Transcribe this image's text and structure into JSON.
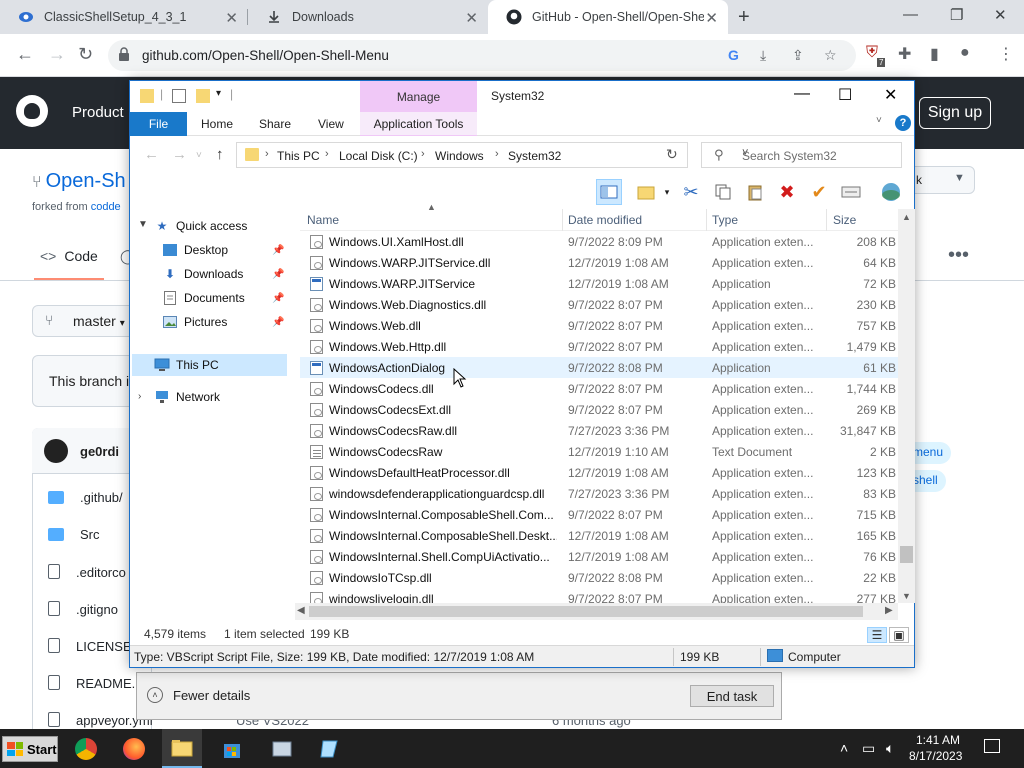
{
  "browser": {
    "tabs": [
      {
        "title": "ClassicShellSetup_4_3_1",
        "icon": "classic-shell-icon"
      },
      {
        "title": "Downloads",
        "icon": "download-icon"
      },
      {
        "title": "GitHub - Open-Shell/Open-Shell",
        "icon": "github-icon"
      }
    ],
    "url": "github.com/Open-Shell/Open-Shell-Menu",
    "extension_badge": "7"
  },
  "github": {
    "product_label": "Product",
    "signup_label": "Sign up",
    "repo_name": "Open-Sh",
    "forked_from_label": "forked from",
    "forked_from_link": "codde",
    "code_tab": "Code",
    "branch": "master",
    "notice": "This branch is",
    "commit_author": "ge0rdi",
    "files": [
      ".github/",
      "Src",
      ".editorco",
      ".gitigno",
      "LICENSE",
      "README.",
      "appveyor.yml"
    ],
    "chips": [
      "menu",
      "shell"
    ],
    "right_box_label": "k",
    "bottom_commit_msg": "Use VS2022",
    "bottom_commit_time": "6 months ago"
  },
  "explorer": {
    "title": "System32",
    "manage_label": "Manage",
    "ribbon_tabs": {
      "file": "File",
      "home": "Home",
      "share": "Share",
      "view": "View",
      "app_tools": "Application Tools"
    },
    "breadcrumbs": [
      "This PC",
      "Local Disk (C:)",
      "Windows",
      "System32"
    ],
    "search_placeholder": "Search System32",
    "nav": {
      "quick_access": "Quick access",
      "desktop": "Desktop",
      "downloads": "Downloads",
      "documents": "Documents",
      "pictures": "Pictures",
      "this_pc": "This PC",
      "network": "Network"
    },
    "columns": {
      "name": "Name",
      "date": "Date modified",
      "type": "Type",
      "size": "Size"
    },
    "files": [
      {
        "name": "Windows.UI.XamlHost.dll",
        "date": "9/7/2022 8:09 PM",
        "type": "Application exten...",
        "size": "208 KB",
        "kind": "dll"
      },
      {
        "name": "Windows.WARP.JITService.dll",
        "date": "12/7/2019 1:08 AM",
        "type": "Application exten...",
        "size": "64 KB",
        "kind": "dll"
      },
      {
        "name": "Windows.WARP.JITService",
        "date": "12/7/2019 1:08 AM",
        "type": "Application",
        "size": "72 KB",
        "kind": "app"
      },
      {
        "name": "Windows.Web.Diagnostics.dll",
        "date": "9/7/2022 8:07 PM",
        "type": "Application exten...",
        "size": "230 KB",
        "kind": "dll"
      },
      {
        "name": "Windows.Web.dll",
        "date": "9/7/2022 8:07 PM",
        "type": "Application exten...",
        "size": "757 KB",
        "kind": "dll"
      },
      {
        "name": "Windows.Web.Http.dll",
        "date": "9/7/2022 8:07 PM",
        "type": "Application exten...",
        "size": "1,479 KB",
        "kind": "dll"
      },
      {
        "name": "WindowsActionDialog",
        "date": "9/7/2022 8:08 PM",
        "type": "Application",
        "size": "61 KB",
        "kind": "app"
      },
      {
        "name": "WindowsCodecs.dll",
        "date": "9/7/2022 8:07 PM",
        "type": "Application exten...",
        "size": "1,744 KB",
        "kind": "dll"
      },
      {
        "name": "WindowsCodecsExt.dll",
        "date": "9/7/2022 8:07 PM",
        "type": "Application exten...",
        "size": "269 KB",
        "kind": "dll"
      },
      {
        "name": "WindowsCodecsRaw.dll",
        "date": "7/27/2023 3:36 PM",
        "type": "Application exten...",
        "size": "31,847 KB",
        "kind": "dll"
      },
      {
        "name": "WindowsCodecsRaw",
        "date": "12/7/2019 1:10 AM",
        "type": "Text Document",
        "size": "2 KB",
        "kind": "txt"
      },
      {
        "name": "WindowsDefaultHeatProcessor.dll",
        "date": "12/7/2019 1:08 AM",
        "type": "Application exten...",
        "size": "123 KB",
        "kind": "dll"
      },
      {
        "name": "windowsdefenderapplicationguardcsp.dll",
        "date": "7/27/2023 3:36 PM",
        "type": "Application exten...",
        "size": "83 KB",
        "kind": "dll"
      },
      {
        "name": "WindowsInternal.ComposableShell.Com...",
        "date": "9/7/2022 8:07 PM",
        "type": "Application exten...",
        "size": "715 KB",
        "kind": "dll"
      },
      {
        "name": "WindowsInternal.ComposableShell.Deskt...",
        "date": "12/7/2019 1:08 AM",
        "type": "Application exten...",
        "size": "165 KB",
        "kind": "dll"
      },
      {
        "name": "WindowsInternal.Shell.CompUiActivatio...",
        "date": "12/7/2019 1:08 AM",
        "type": "Application exten...",
        "size": "76 KB",
        "kind": "dll"
      },
      {
        "name": "WindowsIoTCsp.dll",
        "date": "9/7/2022 8:08 PM",
        "type": "Application exten...",
        "size": "22 KB",
        "kind": "dll"
      },
      {
        "name": "windowslivelogin.dll",
        "date": "9/7/2022 8:07 PM",
        "type": "Application exten...",
        "size": "277 KB",
        "kind": "dll"
      }
    ],
    "status": {
      "items": "4,579 items",
      "selected": "1 item selected",
      "selected_size": "199 KB"
    },
    "details_bar": {
      "info": "Type: VBScript Script File, Size: 199 KB, Date modified: 12/7/2019 1:08 AM",
      "size": "199 KB",
      "location": "Computer"
    }
  },
  "taskmgr": {
    "fewer_details": "Fewer details",
    "end_task": "End task"
  },
  "taskbar": {
    "start": "Start",
    "time": "1:41 AM",
    "date": "8/17/2023"
  }
}
